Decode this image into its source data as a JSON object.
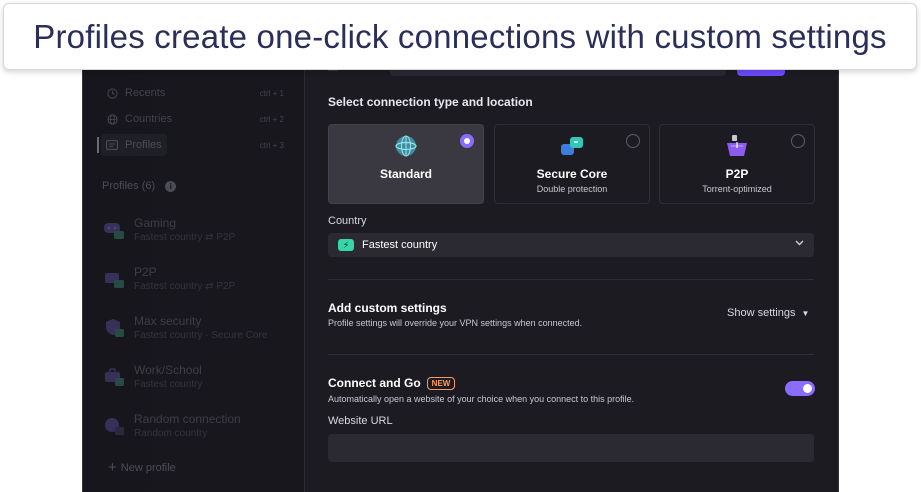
{
  "caption": "Profiles create one-click connections with custom settings",
  "colors": {
    "accent": "#6d4aff",
    "toggle": "#8a6cff",
    "new_badge": "#ff9a5c",
    "fastest_icon": "#36d7a7"
  },
  "sidebar": {
    "nav": [
      {
        "label": "Recents",
        "shortcut": "ctrl + 1",
        "icon": "clock-icon"
      },
      {
        "label": "Countries",
        "shortcut": "ctrl + 2",
        "icon": "globe-icon"
      },
      {
        "label": "Profiles",
        "shortcut": "ctrl + 3",
        "icon": "profiles-icon"
      }
    ],
    "profiles_heading": "Profiles (6)",
    "profiles": [
      {
        "name": "Gaming",
        "sub": "Fastest country",
        "tag": "P2P",
        "icon": "gamepad-icon"
      },
      {
        "name": "P2P",
        "sub": "Fastest country",
        "tag": "P2P",
        "icon": "p2p-icon"
      },
      {
        "name": "Max security",
        "sub": "Fastest country · Secure Core",
        "tag": "",
        "icon": "shield-icon"
      },
      {
        "name": "Work/School",
        "sub": "Fastest country",
        "tag": "",
        "icon": "briefcase-icon"
      },
      {
        "name": "Random connection",
        "sub": "Random country",
        "tag": "",
        "icon": "dice-icon"
      }
    ],
    "new_profile": "New profile"
  },
  "main": {
    "section_title": "Select connection type and location",
    "cards": [
      {
        "title": "Standard",
        "subtitle": "",
        "selected": true,
        "icon": "globe-icon"
      },
      {
        "title": "Secure Core",
        "subtitle": "Double protection",
        "selected": false,
        "icon": "secure-core-icon"
      },
      {
        "title": "P2P",
        "subtitle": "Torrent-optimized",
        "selected": false,
        "icon": "p2p-basket-icon"
      }
    ],
    "country_label": "Country",
    "country_value": "Fastest country",
    "advanced_title": "Add custom settings",
    "advanced_subtitle": "Profile settings will override your VPN settings when connected.",
    "show_settings": "Show settings",
    "cg_title": "Connect and Go",
    "cg_badge": "NEW",
    "cg_subtitle": "Automatically open a website of your choice when you connect to this profile.",
    "cg_enabled": true,
    "url_label": "Website URL",
    "url_value": ""
  }
}
